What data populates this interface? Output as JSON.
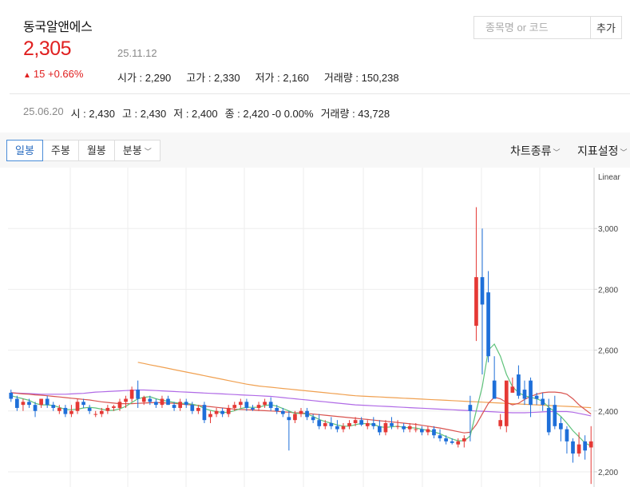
{
  "stock": {
    "name": "동국알앤에스",
    "price": "2,305",
    "change_arrow": "▲",
    "change_text": "15 +0.66%",
    "date": "25.11.12",
    "open": "시가 : 2,290",
    "high": "고가 : 2,330",
    "low": "저가 : 2,160",
    "volume": "거래량 : 150,238"
  },
  "search": {
    "placeholder": "종목명 or 코드",
    "button": "추가"
  },
  "history": {
    "date": "25.06.20",
    "open": "시 : 2,430",
    "high": "고 : 2,430",
    "low": "저 : 2,400",
    "close": "종 : 2,420 -0 0.00%",
    "volume": "거래량 : 43,728"
  },
  "tabs": [
    "일봉",
    "주봉",
    "월봉",
    "분봉"
  ],
  "tools": {
    "chart_type": "차트종류",
    "indicator": "지표설정"
  },
  "chart_data": {
    "type": "candlestick",
    "y_scale_label": "Linear",
    "ylim": [
      2150,
      3200
    ],
    "yticks": [
      "3,000",
      "2,800",
      "2,600",
      "2,400",
      "2,200"
    ],
    "ytick_values": [
      3000,
      2800,
      2600,
      2400,
      2200
    ],
    "candles": [
      [
        2460,
        2470,
        2430,
        2440
      ],
      [
        2440,
        2450,
        2400,
        2410
      ],
      [
        2420,
        2440,
        2400,
        2430
      ],
      [
        2430,
        2440,
        2410,
        2420
      ],
      [
        2420,
        2430,
        2380,
        2400
      ],
      [
        2420,
        2440,
        2410,
        2440
      ],
      [
        2440,
        2450,
        2410,
        2420
      ],
      [
        2420,
        2430,
        2400,
        2410
      ],
      [
        2400,
        2420,
        2390,
        2410
      ],
      [
        2410,
        2420,
        2380,
        2390
      ],
      [
        2390,
        2420,
        2380,
        2400
      ],
      [
        2400,
        2440,
        2390,
        2430
      ],
      [
        2430,
        2440,
        2410,
        2420
      ],
      [
        2410,
        2420,
        2390,
        2400
      ],
      [
        2390,
        2400,
        2380,
        2390
      ],
      [
        2390,
        2410,
        2380,
        2400
      ],
      [
        2400,
        2420,
        2390,
        2410
      ],
      [
        2410,
        2420,
        2400,
        2415
      ],
      [
        2410,
        2440,
        2400,
        2430
      ],
      [
        2430,
        2450,
        2410,
        2440
      ],
      [
        2440,
        2480,
        2430,
        2470
      ],
      [
        2470,
        2500,
        2410,
        2440
      ],
      [
        2430,
        2450,
        2420,
        2445
      ],
      [
        2440,
        2450,
        2420,
        2430
      ],
      [
        2430,
        2440,
        2410,
        2420
      ],
      [
        2420,
        2450,
        2410,
        2440
      ],
      [
        2440,
        2450,
        2420,
        2420
      ],
      [
        2420,
        2430,
        2400,
        2410
      ],
      [
        2410,
        2440,
        2400,
        2430
      ],
      [
        2430,
        2440,
        2410,
        2420
      ],
      [
        2420,
        2430,
        2390,
        2400
      ],
      [
        2400,
        2420,
        2390,
        2410
      ],
      [
        2420,
        2430,
        2360,
        2370
      ],
      [
        2380,
        2400,
        2360,
        2390
      ],
      [
        2390,
        2410,
        2380,
        2400
      ],
      [
        2400,
        2410,
        2380,
        2390
      ],
      [
        2390,
        2420,
        2380,
        2410
      ],
      [
        2410,
        2430,
        2400,
        2420
      ],
      [
        2420,
        2440,
        2410,
        2430
      ],
      [
        2430,
        2440,
        2400,
        2410
      ],
      [
        2410,
        2420,
        2400,
        2405
      ],
      [
        2410,
        2430,
        2400,
        2420
      ],
      [
        2420,
        2440,
        2410,
        2430
      ],
      [
        2430,
        2445,
        2400,
        2410
      ],
      [
        2410,
        2420,
        2390,
        2400
      ],
      [
        2400,
        2410,
        2380,
        2390
      ],
      [
        2380,
        2400,
        2270,
        2370
      ],
      [
        2370,
        2400,
        2360,
        2390
      ],
      [
        2390,
        2410,
        2380,
        2400
      ],
      [
        2400,
        2410,
        2370,
        2380
      ],
      [
        2380,
        2390,
        2360,
        2370
      ],
      [
        2370,
        2390,
        2340,
        2350
      ],
      [
        2350,
        2370,
        2340,
        2360
      ],
      [
        2360,
        2380,
        2340,
        2350
      ],
      [
        2350,
        2370,
        2330,
        2340
      ],
      [
        2340,
        2360,
        2330,
        2350
      ],
      [
        2350,
        2370,
        2340,
        2360
      ],
      [
        2360,
        2380,
        2350,
        2370
      ],
      [
        2370,
        2380,
        2350,
        2355
      ],
      [
        2350,
        2370,
        2340,
        2360
      ],
      [
        2360,
        2380,
        2340,
        2350
      ],
      [
        2350,
        2370,
        2320,
        2330
      ],
      [
        2330,
        2370,
        2320,
        2360
      ],
      [
        2360,
        2380,
        2340,
        2350
      ],
      [
        2350,
        2370,
        2340,
        2350
      ],
      [
        2350,
        2360,
        2330,
        2340
      ],
      [
        2340,
        2360,
        2330,
        2350
      ],
      [
        2340,
        2360,
        2330,
        2340
      ],
      [
        2340,
        2350,
        2320,
        2330
      ],
      [
        2330,
        2350,
        2320,
        2340
      ],
      [
        2340,
        2350,
        2310,
        2320
      ],
      [
        2320,
        2340,
        2300,
        2310
      ],
      [
        2310,
        2320,
        2290,
        2300
      ],
      [
        2300,
        2310,
        2290,
        2295
      ],
      [
        2290,
        2310,
        2280,
        2300
      ],
      [
        2300,
        2320,
        2280,
        2310
      ],
      [
        2420,
        2450,
        2300,
        2400
      ],
      [
        2680,
        3070,
        2630,
        2840
      ],
      [
        2840,
        3000,
        2520,
        2750
      ],
      [
        2790,
        2860,
        2560,
        2580
      ],
      [
        2500,
        2580,
        2460,
        2440
      ],
      [
        2350,
        2390,
        2340,
        2370
      ],
      [
        2350,
        2400,
        2330,
        2500
      ],
      [
        2460,
        2510,
        2460,
        2480
      ],
      [
        2520,
        2550,
        2440,
        2450
      ],
      [
        2470,
        2500,
        2420,
        2440
      ],
      [
        2500,
        2510,
        2380,
        2420
      ],
      [
        2450,
        2460,
        2420,
        2440
      ],
      [
        2440,
        2460,
        2400,
        2420
      ],
      [
        2410,
        2440,
        2320,
        2330
      ],
      [
        2420,
        2450,
        2340,
        2350
      ],
      [
        2360,
        2380,
        2300,
        2340
      ],
      [
        2340,
        2350,
        2260,
        2300
      ],
      [
        2300,
        2310,
        2230,
        2260
      ],
      [
        2260,
        2330,
        2250,
        2290
      ],
      [
        2300,
        2320,
        2240,
        2270
      ],
      [
        2280,
        2350,
        2160,
        2300
      ]
    ],
    "ma_short": [
      2450,
      2445,
      2440,
      2435,
      2425,
      2420,
      2420,
      2418,
      2412,
      2405,
      2404,
      2406,
      2410,
      2412,
      2410,
      2406,
      2402,
      2402,
      2407,
      2415,
      2428,
      2440,
      2445,
      2447,
      2440,
      2435,
      2432,
      2428,
      2425,
      2425,
      2422,
      2418,
      2408,
      2402,
      2398,
      2395,
      2396,
      2401,
      2408,
      2412,
      2412,
      2412,
      2418,
      2420,
      2416,
      2408,
      2400,
      2392,
      2392,
      2390,
      2382,
      2372,
      2365,
      2360,
      2354,
      2350,
      2350,
      2355,
      2359,
      2358,
      2356,
      2348,
      2346,
      2348,
      2350,
      2346,
      2345,
      2344,
      2340,
      2336,
      2331,
      2325,
      2316,
      2308,
      2302,
      2302,
      2318,
      2400,
      2480,
      2600,
      2620,
      2580,
      2520,
      2480,
      2460,
      2450,
      2445,
      2440,
      2432,
      2412,
      2398,
      2382,
      2360,
      2335,
      2315,
      2295,
      2285
    ],
    "ma_mid": [
      2460,
      2458,
      2456,
      2455,
      2453,
      2452,
      2450,
      2448,
      2446,
      2444,
      2442,
      2440,
      2438,
      2436,
      2433,
      2430,
      2428,
      2426,
      2424,
      2424,
      2424,
      2425,
      2426,
      2427,
      2428,
      2427,
      2426,
      2425,
      2423,
      2421,
      2420,
      2418,
      2416,
      2414,
      2412,
      2410,
      2408,
      2406,
      2405,
      2404,
      2403,
      2402,
      2401,
      2400,
      2399,
      2397,
      2396,
      2394,
      2393,
      2392,
      2390,
      2388,
      2386,
      2384,
      2382,
      2380,
      2378,
      2376,
      2374,
      2372,
      2370,
      2368,
      2366,
      2364,
      2362,
      2360,
      2358,
      2356,
      2353,
      2350,
      2347,
      2344,
      2340,
      2336,
      2332,
      2328,
      2330,
      2355,
      2390,
      2425,
      2445,
      2440,
      2428,
      2420,
      2425,
      2438,
      2448,
      2455,
      2460,
      2462,
      2462,
      2460,
      2455,
      2440,
      2420,
      2405,
      2390
    ],
    "ma_long": [
      null,
      null,
      null,
      null,
      null,
      null,
      null,
      null,
      null,
      null,
      null,
      null,
      null,
      null,
      null,
      null,
      null,
      null,
      null,
      null,
      null,
      2560,
      2556,
      2552,
      2548,
      2544,
      2540,
      2536,
      2532,
      2528,
      2524,
      2520,
      2516,
      2512,
      2508,
      2504,
      2500,
      2496,
      2492,
      2488,
      2485,
      2482,
      2480,
      2478,
      2476,
      2474,
      2472,
      2470,
      2468,
      2466,
      2464,
      2462,
      2460,
      2458,
      2456,
      2454,
      2452,
      2450,
      2449,
      2448,
      2447,
      2446,
      2445,
      2444,
      2443,
      2442,
      2441,
      2440,
      2439,
      2438,
      2437,
      2436,
      2435,
      2434,
      2433,
      2432,
      2431,
      2430,
      2429,
      2428,
      2427,
      2426,
      2425,
      2424,
      2423,
      2422,
      2421,
      2420,
      2419,
      2418,
      2417,
      2416,
      2415,
      2414,
      2413,
      2412,
      2411
    ],
    "ma_xlong": [
      2460,
      2459,
      2458,
      2457,
      2456,
      2455,
      2455,
      2455,
      2455,
      2455,
      2456,
      2457,
      2458,
      2460,
      2462,
      2463,
      2464,
      2465,
      2466,
      2467,
      2468,
      2469,
      2469,
      2468,
      2467,
      2466,
      2465,
      2464,
      2463,
      2462,
      2461,
      2460,
      2459,
      2458,
      2457,
      2456,
      2455,
      2454,
      2453,
      2452,
      2451,
      2450,
      2449,
      2448,
      2446,
      2444,
      2442,
      2440,
      2438,
      2436,
      2434,
      2432,
      2430,
      2428,
      2426,
      2424,
      2422,
      2420,
      2419,
      2418,
      2417,
      2416,
      2415,
      2414,
      2413,
      2412,
      2411,
      2410,
      2409,
      2408,
      2407,
      2406,
      2405,
      2404,
      2403,
      2402,
      2401,
      2400,
      2399,
      2398,
      2397,
      2396,
      2395,
      2394,
      2394,
      2394,
      2395,
      2396,
      2397,
      2398,
      2398,
      2398,
      2398,
      2396,
      2392,
      2388,
      2384
    ],
    "colors": {
      "up": "#e53935",
      "down": "#1e6fd9",
      "ma_short": "#5ec27a",
      "ma_mid": "#d9534f",
      "ma_long": "#f0a050",
      "ma_xlong": "#b06ae6"
    }
  }
}
